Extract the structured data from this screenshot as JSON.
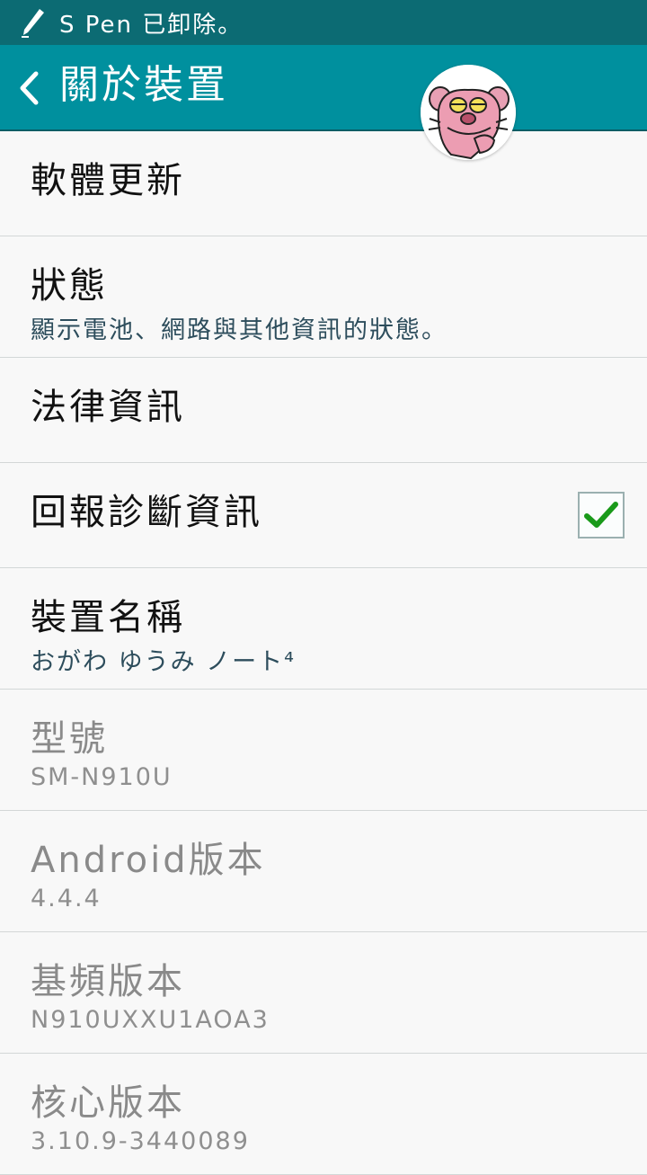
{
  "status_bar": {
    "notification": "S Pen 已卸除。",
    "pen_icon": "pen-icon"
  },
  "action_bar": {
    "back_icon": "chevron-left-icon",
    "title": "關於裝置"
  },
  "items": [
    {
      "title": "軟體更新",
      "subtitle": ""
    },
    {
      "title": "狀態",
      "subtitle": "顯示電池、網路與其他資訊的狀態。"
    },
    {
      "title": "法律資訊",
      "subtitle": ""
    },
    {
      "title": "回報診斷資訊",
      "subtitle": "",
      "checked": true
    },
    {
      "title": "裝置名稱",
      "subtitle": "おがわ ゆうみ ノート⁴"
    },
    {
      "title": "型號",
      "subtitle": "SM-N910U"
    },
    {
      "title": "Android版本",
      "subtitle": "4.4.4"
    },
    {
      "title": "基頻版本",
      "subtitle": "N910UXXU1AOA3"
    },
    {
      "title": "核心版本",
      "subtitle": "3.10.9-3440089"
    }
  ],
  "colors": {
    "status_bar": "#0c6b73",
    "action_bar": "#00909e",
    "check": "#1a9a1a"
  }
}
